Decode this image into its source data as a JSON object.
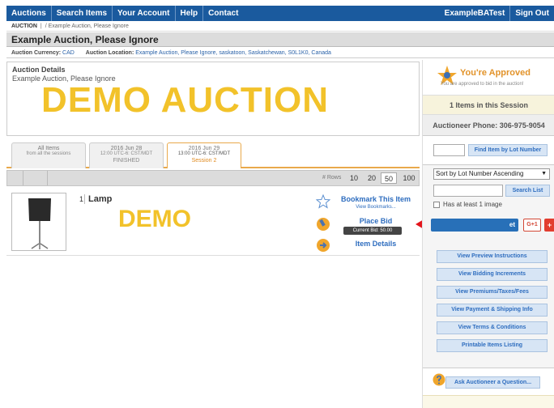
{
  "nav": {
    "items": [
      "Auctions",
      "Search Items",
      "Your Account",
      "Help",
      "Contact"
    ],
    "user": "ExampleBATest",
    "sign_out": "Sign Out"
  },
  "breadcrumb": {
    "root": "AUCTION",
    "sep": "|",
    "path": "/ Example Auction, Please Ignore"
  },
  "title": "Example Auction, Please Ignore",
  "meta": {
    "currency_label": "Auction Currency:",
    "currency": "CAD",
    "location_label": "Auction Location:",
    "location": "Example Auction, Please Ignore, saskatoon, Saskatchewan, S0L1K0, Canada"
  },
  "details": {
    "header": "Auction Details",
    "description": "Example Auction, Please Ignore",
    "watermark": "DEMO AUCTION"
  },
  "sessions": [
    {
      "line1": "All Items",
      "line2": "from all the sessions",
      "line3": ""
    },
    {
      "line1": "2016 Jun 28",
      "line2": "12:00 UTC-6: CST/MDT",
      "line3": "FINISHED"
    },
    {
      "line1": "2016 Jun 29",
      "line2": "13:00 UTC-6: CST/MDT",
      "line3": "Session 2"
    }
  ],
  "rows": {
    "label": "# Rows",
    "options": [
      "10",
      "20",
      "50",
      "100"
    ],
    "selected": "50"
  },
  "lot": {
    "number": "1",
    "name": "Lamp",
    "watermark": "DEMO",
    "bookmark": "Bookmark This Item",
    "view_bookmarks": "View Bookmarks...",
    "place_bid": "Place Bid",
    "current_bid": "Current Bid: 50.00",
    "item_details": "Item Details"
  },
  "sidebar": {
    "approved_title": "You're Approved",
    "approved_sub": "You are approved to bid in the auction!",
    "items_in_session": "1 Items in this Session",
    "phone": "Auctioneer Phone: 306-975-9054",
    "find_lot": "Find Item by Lot Number",
    "sort": "Sort by Lot Number Ascending",
    "search_list": "Search List",
    "has_image": "Has at least 1 image",
    "share_tweet": "et",
    "share_gplus": "G+1",
    "links": [
      "View Preview Instructions",
      "View Bidding Increments",
      "View Premiums/Taxes/Fees",
      "View Payment & Shipping Info",
      "View Terms & Conditions",
      "Printable Items Listing"
    ],
    "ask": "Ask Auctioneer a Question..."
  },
  "colors": {
    "nav_blue": "#1a5a9e",
    "watermark": "#f2c22a",
    "link_blue": "#2e6dbf",
    "arrow_red": "#e3141b"
  }
}
